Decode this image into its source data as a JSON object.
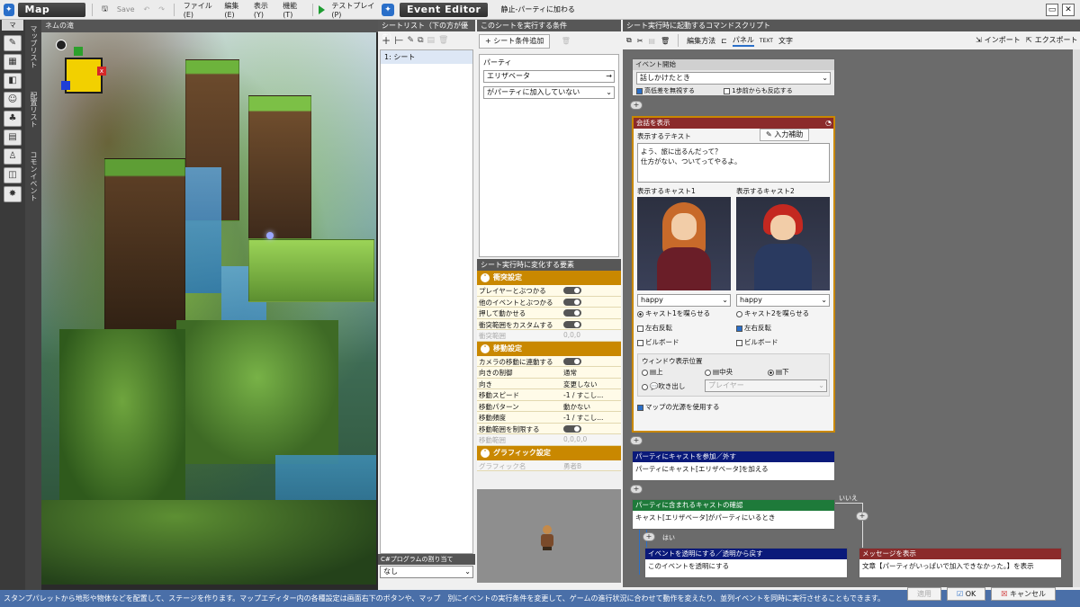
{
  "map_editor": {
    "title": "Map Editor",
    "save": "Save",
    "menus": [
      "ファイル(E)",
      "編集(E)",
      "表示(Y)",
      "機能(T)"
    ],
    "test_play": "テストプレイ(P)",
    "left_tab": "マ",
    "vertical_tabs": [
      "マップリスト",
      "配置リスト",
      "コモンイベント"
    ],
    "canvas_label": "ネムの滝",
    "gizmo_x": "x"
  },
  "event_editor": {
    "title": "Event Editor",
    "event_name": "静止-パーティに加わる",
    "sheet_list": {
      "header": "シートリスト（下の方が優先）",
      "items": [
        "1: シート"
      ],
      "csharp_header": "C#プログラムの割り当て",
      "csharp_value": "なし"
    },
    "conditions": {
      "header": "このシートを実行する条件",
      "add_button": "シート条件追加",
      "party_label": "パーティ",
      "party_member": "エリザベータ",
      "party_state": "がパーティに加入していない"
    },
    "variables": {
      "header": "シート実行時に変化する要素",
      "collision": {
        "title": "衝突設定",
        "rows": [
          {
            "k": "プレイヤーとぶつかる",
            "type": "toggle"
          },
          {
            "k": "他のイベントとぶつかる",
            "type": "toggle"
          },
          {
            "k": "押して動かせる",
            "type": "toggle"
          },
          {
            "k": "衝突範囲をカスタムする",
            "type": "toggle"
          },
          {
            "k": "衝突範囲",
            "v": "0,0,0",
            "disabled": true
          }
        ]
      },
      "movement": {
        "title": "移動設定",
        "rows": [
          {
            "k": "カメラの移動に連動する",
            "type": "toggle"
          },
          {
            "k": "向きの制御",
            "v": "通常"
          },
          {
            "k": "向き",
            "v": "変更しない"
          },
          {
            "k": "移動スピード",
            "v": "-1 / すこし..."
          },
          {
            "k": "移動パターン",
            "v": "動かない"
          },
          {
            "k": "移動頻度",
            "v": "-1 / すこし..."
          },
          {
            "k": "移動範囲を制限する",
            "type": "toggle"
          },
          {
            "k": "移動範囲",
            "v": "0,0,0,0",
            "disabled": true
          }
        ]
      },
      "graphic": {
        "title": "グラフィック設定",
        "rows": [
          {
            "k": "グラフィック名",
            "v": "勇者B",
            "disabled": true
          }
        ]
      }
    },
    "script": {
      "header": "シート実行時に起動するコマンドスクリプト",
      "tools": [
        "編集方法",
        "パネル",
        "文字"
      ],
      "import": "インポート",
      "export": "エクスポート",
      "trigger": {
        "title": "イベント開始",
        "type": "話しかけたとき",
        "ignore_height": "高低差を無視する",
        "one_step": "1歩前からも反応する"
      },
      "dialogue": {
        "title": "会話を表示",
        "text_label": "表示するテキスト",
        "input_help": "入力補助",
        "line1": "よう、旅に出るんだって？",
        "line2": "仕方がない、ついてってやるよ。",
        "cast1_label": "表示するキャスト1",
        "cast2_label": "表示するキャスト2",
        "cast1_expr": "happy",
        "cast2_expr": "happy",
        "speaker1": "キャスト1を喋らせる",
        "speaker2": "キャスト2を喋らせる",
        "flip1": "左右反転",
        "flip2": "左右反転",
        "billboard1": "ビルボード",
        "billboard2": "ビルボード",
        "window_pos_label": "ウィンドウ表示位置",
        "pos_top": "上",
        "pos_center": "中央",
        "pos_bottom": "下",
        "bubble": "吹き出し",
        "bubble_target": "プレイヤー",
        "use_light": "マップの光源を使用する"
      },
      "party_add": {
        "title": "パーティにキャストを参加／外す",
        "body": "パーティにキャスト[エリザベータ]を加える"
      },
      "party_check": {
        "title": "パーティに含まれるキャストの確認",
        "body": "キャスト[エリザベータ]がパーティにいるとき",
        "yes": "はい",
        "no": "いいえ"
      },
      "transparent": {
        "title": "イベントを透明にする／透明から戻す",
        "body": "このイベントを透明にする"
      },
      "message": {
        "title": "メッセージを表示",
        "body": "文章【パーティがいっぱいで加入できなかった。】を表示"
      }
    },
    "footer": {
      "apply": "適用",
      "ok": "OK",
      "cancel": "キャンセル"
    }
  },
  "status_bar": "スタンプパレットから地形や物体などを配置して、ステージを作ります。マップエディター内の各種設定は画面右下のボタンや、マップ　別にイベントの実行条件を変更して、ゲームの進行状況に合わせて動作を変えたり、並列イベントを同時に実行させることもできます。",
  "colors": {
    "accent_orange": "#c98800",
    "party_add_head": "#0a1a7a",
    "party_check_head": "#1e7a3a",
    "message_head": "#8b2b2b",
    "status_bar": "#4a6fa8"
  }
}
